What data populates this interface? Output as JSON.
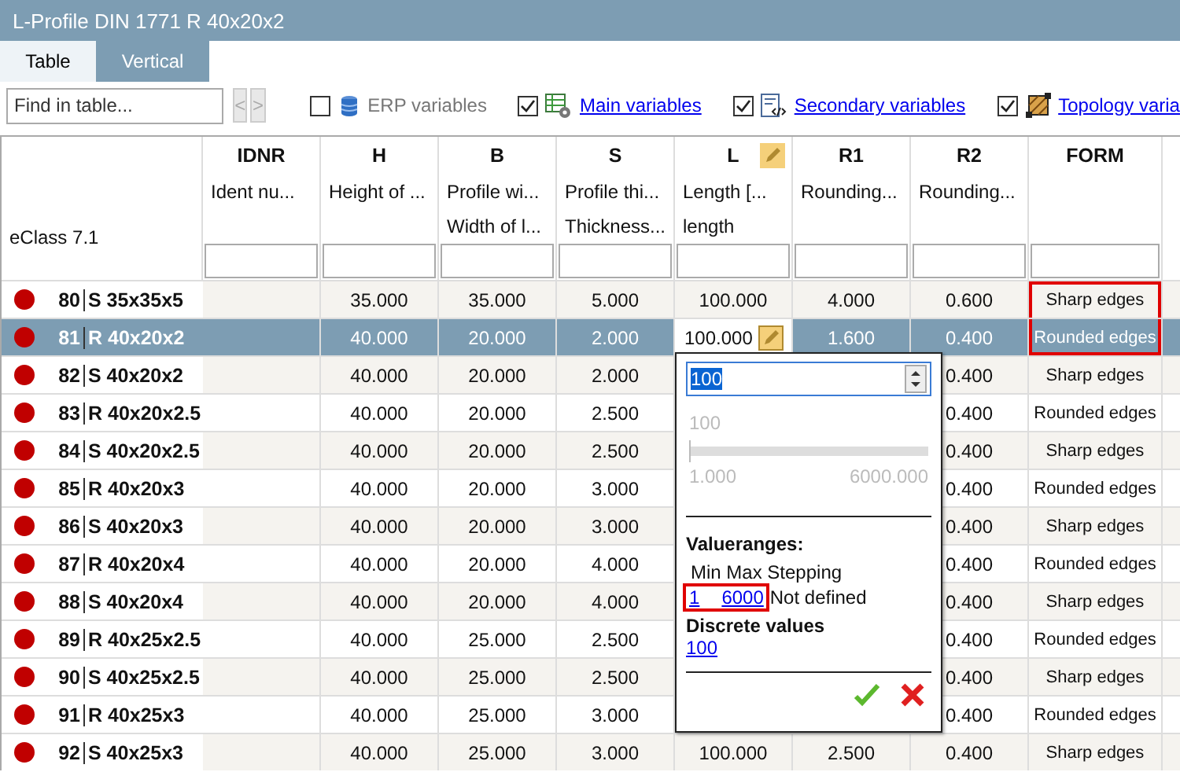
{
  "window": {
    "title": "L-Profile DIN 1771 R 40x20x2"
  },
  "tabs": [
    {
      "label": "Table",
      "selected": true
    },
    {
      "label": "Vertical",
      "selected": false
    }
  ],
  "toolbar": {
    "search": {
      "placeholder": "Find in table..."
    },
    "prev": {
      "label": "<",
      "disabled": true
    },
    "next": {
      "label": ">",
      "disabled": true
    },
    "filters": [
      {
        "label": "ERP variables",
        "checked": false
      },
      {
        "label": "Main variables",
        "checked": true
      },
      {
        "label": "Secondary variables",
        "checked": true
      },
      {
        "label": "Topology varia",
        "checked": true
      }
    ]
  },
  "table": {
    "row_header": "eClass 7.1",
    "columns": [
      {
        "code": "IDNR",
        "desc": [
          "Ident nu..."
        ]
      },
      {
        "code": "H",
        "desc": [
          "Height of ..."
        ]
      },
      {
        "code": "B",
        "desc": [
          "Profile wi...",
          "Width of l..."
        ]
      },
      {
        "code": "S",
        "desc": [
          "Profile thi...",
          "Thickness..."
        ]
      },
      {
        "code": "L",
        "desc": [
          "Length [...",
          "length"
        ],
        "editable": true
      },
      {
        "code": "R1",
        "desc": [
          "Rounding..."
        ]
      },
      {
        "code": "R2",
        "desc": [
          "Rounding..."
        ]
      },
      {
        "code": "FORM"
      }
    ],
    "rows": [
      {
        "id": "80",
        "name": "S 35x35x5",
        "color": "#c00000",
        "selected": false,
        "editing": false,
        "form_marked": true,
        "cells": [
          null,
          "35.000",
          "35.000",
          "5.000",
          "100.000",
          "4.000",
          "0.600",
          "Sharp edges"
        ]
      },
      {
        "id": "81",
        "name": "R 40x20x2",
        "color": "#c00000",
        "selected": true,
        "editing": true,
        "form_marked": true,
        "cells": [
          null,
          "40.000",
          "20.000",
          "2.000",
          "100.000",
          "1.600",
          "0.400",
          "Rounded edges"
        ]
      },
      {
        "id": "82",
        "name": "S 40x20x2",
        "color": "#c00000",
        "selected": false,
        "editing": false,
        "form_marked": false,
        "cells": [
          null,
          "40.000",
          "20.000",
          "2.000",
          null,
          null,
          "0.400",
          "Sharp edges"
        ]
      },
      {
        "id": "83",
        "name": "R 40x20x2.5",
        "color": "#c00000",
        "selected": false,
        "editing": false,
        "form_marked": false,
        "cells": [
          null,
          "40.000",
          "20.000",
          "2.500",
          null,
          null,
          "0.400",
          "Rounded edges"
        ]
      },
      {
        "id": "84",
        "name": "S 40x20x2.5",
        "color": "#c00000",
        "selected": false,
        "editing": false,
        "form_marked": false,
        "cells": [
          null,
          "40.000",
          "20.000",
          "2.500",
          null,
          null,
          "0.400",
          "Sharp edges"
        ]
      },
      {
        "id": "85",
        "name": "R 40x20x3",
        "color": "#c00000",
        "selected": false,
        "editing": false,
        "form_marked": false,
        "cells": [
          null,
          "40.000",
          "20.000",
          "3.000",
          null,
          null,
          "0.400",
          "Rounded edges"
        ]
      },
      {
        "id": "86",
        "name": "S 40x20x3",
        "color": "#c00000",
        "selected": false,
        "editing": false,
        "form_marked": false,
        "cells": [
          null,
          "40.000",
          "20.000",
          "3.000",
          null,
          null,
          "0.400",
          "Sharp edges"
        ]
      },
      {
        "id": "87",
        "name": "R 40x20x4",
        "color": "#c00000",
        "selected": false,
        "editing": false,
        "form_marked": false,
        "cells": [
          null,
          "40.000",
          "20.000",
          "4.000",
          null,
          null,
          "0.400",
          "Rounded edges"
        ]
      },
      {
        "id": "88",
        "name": "S 40x20x4",
        "color": "#c00000",
        "selected": false,
        "editing": false,
        "form_marked": false,
        "cells": [
          null,
          "40.000",
          "20.000",
          "4.000",
          null,
          null,
          "0.400",
          "Sharp edges"
        ]
      },
      {
        "id": "89",
        "name": "R 40x25x2.5",
        "color": "#c00000",
        "selected": false,
        "editing": false,
        "form_marked": false,
        "cells": [
          null,
          "40.000",
          "25.000",
          "2.500",
          null,
          null,
          "0.400",
          "Rounded edges"
        ]
      },
      {
        "id": "90",
        "name": "S 40x25x2.5",
        "color": "#c00000",
        "selected": false,
        "editing": false,
        "form_marked": false,
        "cells": [
          null,
          "40.000",
          "25.000",
          "2.500",
          null,
          null,
          "0.400",
          "Sharp edges"
        ]
      },
      {
        "id": "91",
        "name": "R 40x25x3",
        "color": "#c00000",
        "selected": false,
        "editing": false,
        "form_marked": false,
        "cells": [
          null,
          "40.000",
          "25.000",
          "3.000",
          null,
          null,
          "0.400",
          "Rounded edges"
        ]
      },
      {
        "id": "92",
        "name": "S 40x25x3",
        "color": "#c00000",
        "selected": false,
        "editing": false,
        "form_marked": false,
        "cells": [
          null,
          "40.000",
          "25.000",
          "3.000",
          "100.000",
          "2.500",
          "0.400",
          "Sharp edges"
        ]
      }
    ]
  },
  "editor": {
    "value": "100",
    "slider": {
      "reading": "100",
      "level": 0,
      "min": "1.000",
      "max": "6000.000",
      "disabled": true
    },
    "ranges_title": "Valueranges:",
    "ranges_header": "Min Max Stepping",
    "range_min": "1",
    "range_max": "6000",
    "range_step": "Not defined",
    "range_marked": true,
    "discrete_title": "Discrete values",
    "discrete_values": [
      "100"
    ]
  }
}
